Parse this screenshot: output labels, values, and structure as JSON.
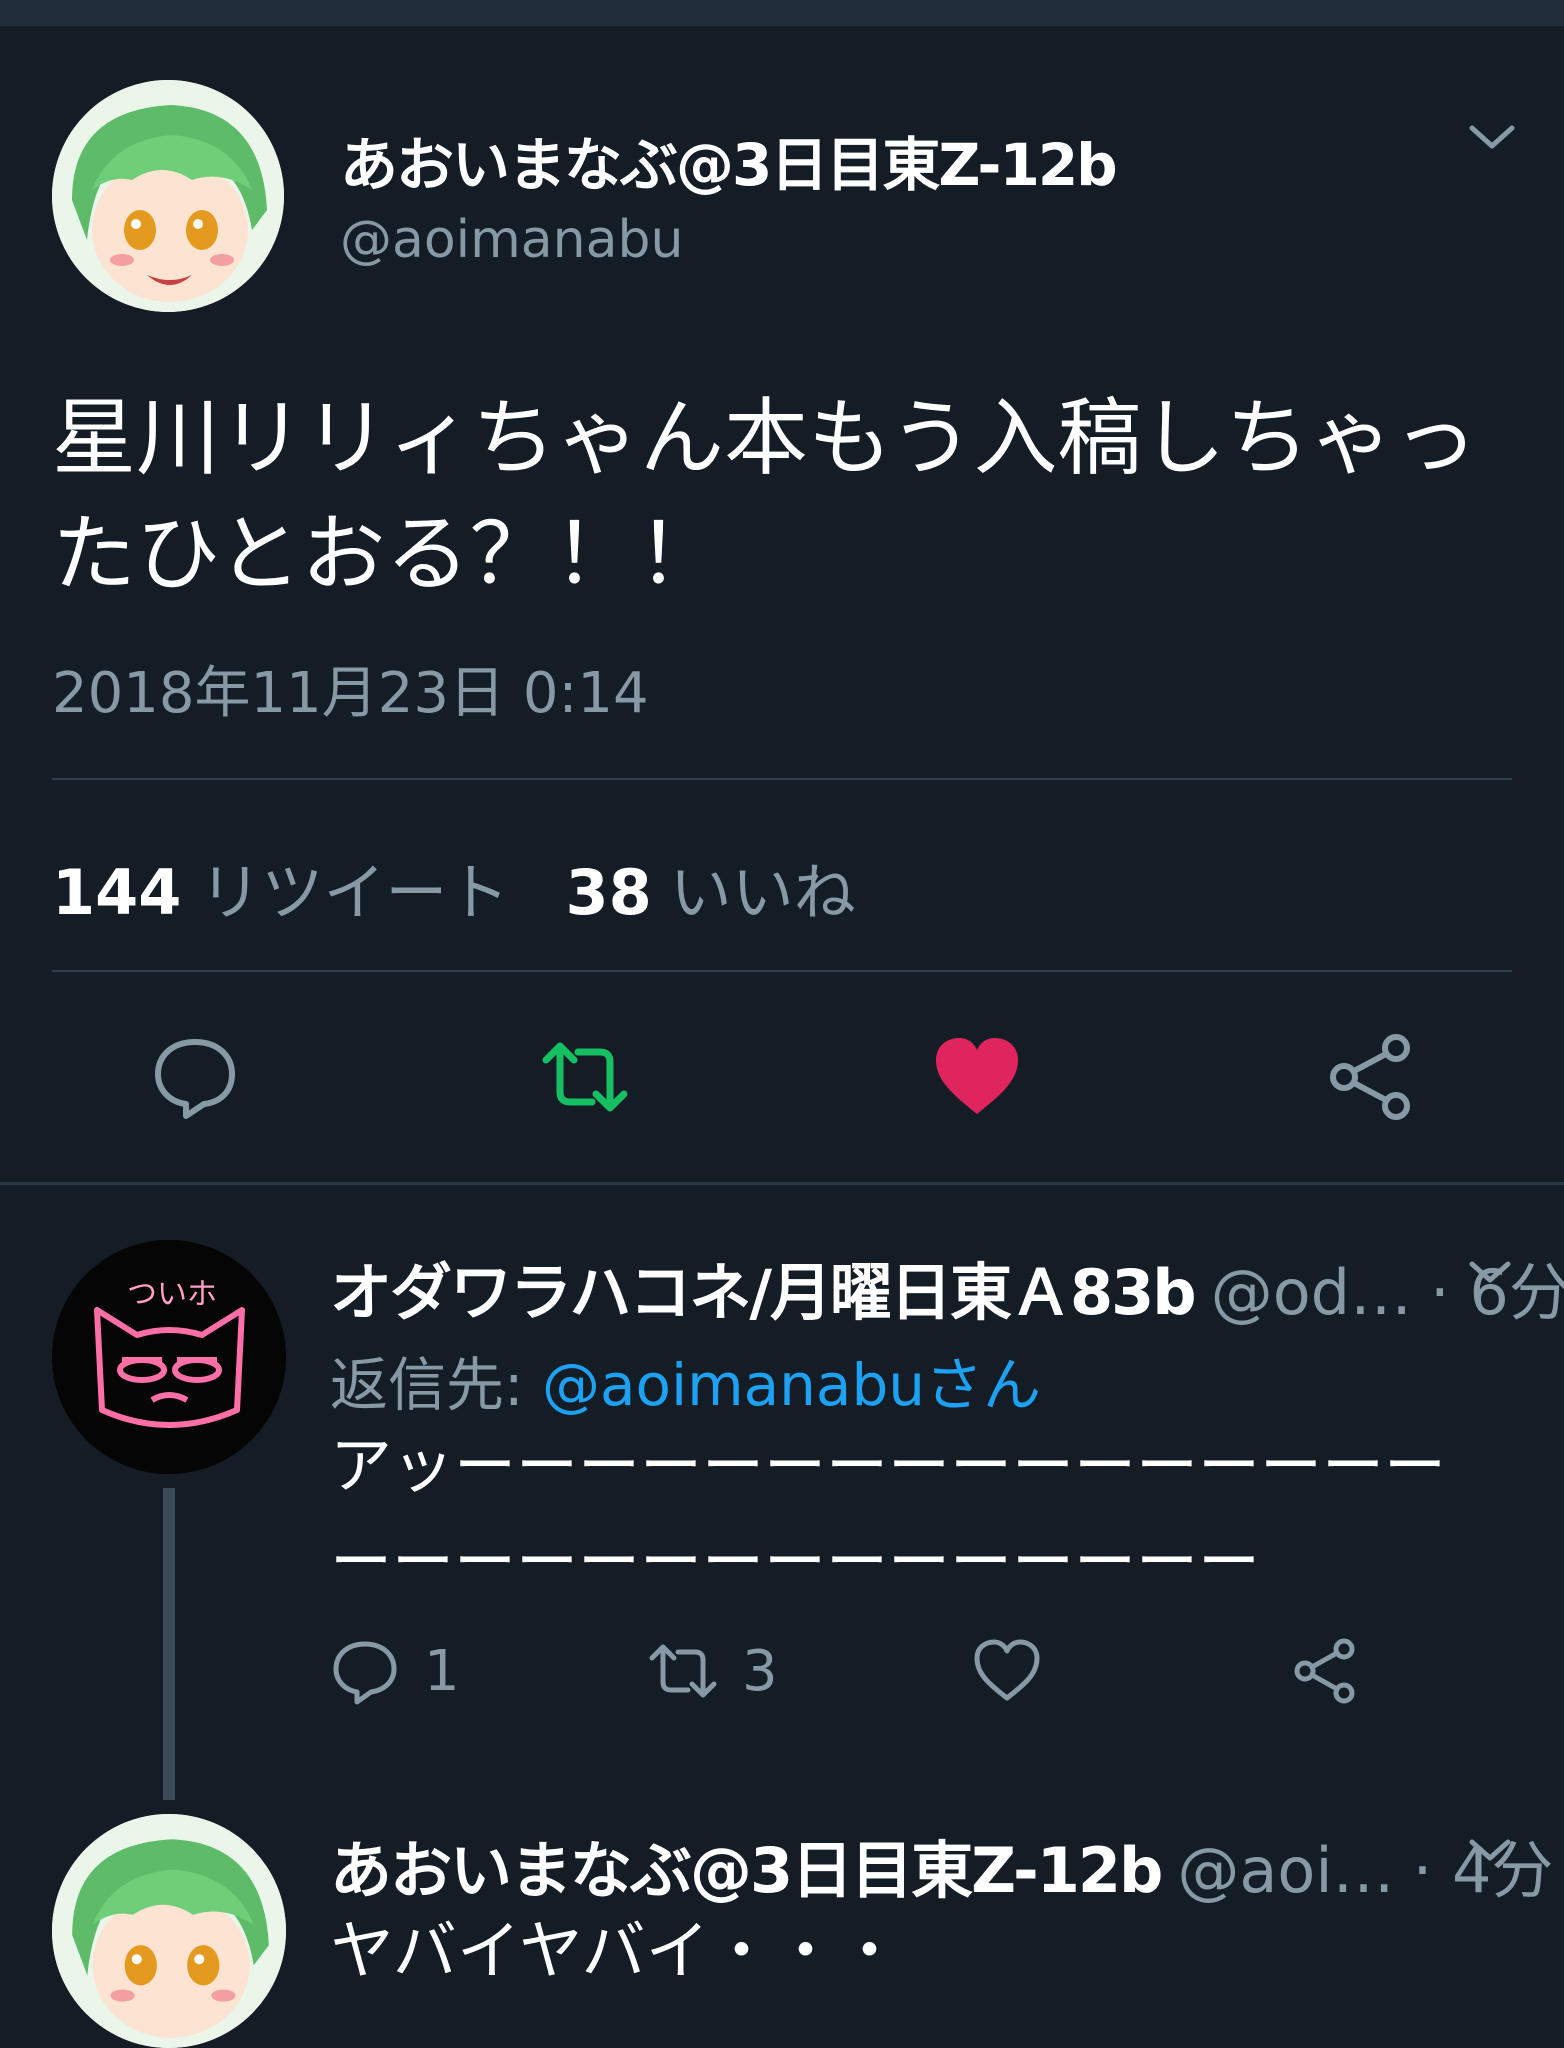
{
  "main_tweet": {
    "display_name": "あおいまなぶ@3日目東Z-12b",
    "handle": "@aoimanabu",
    "text": "星川リリィちゃん本もう入稿しちゃったひとおる？！！",
    "timestamp": "2018年11月23日 0:14",
    "retweet_count": "144",
    "retweet_label": "リツイート",
    "like_count": "38",
    "like_label": "いいね",
    "avatar_icon": "anime-avatar-green-hair",
    "colors": {
      "retweet_active": "#17bf63",
      "like_active": "#e0245e",
      "muted": "#8899a6"
    }
  },
  "reply": {
    "display_name": "オダワラハコネ/月曜日東Ａ83b",
    "handle": "@od…",
    "time": "· 6分",
    "reply_to_label": "返信先:",
    "reply_to_mention": "@aoimanabuさん",
    "text": "アッーーーーーーーーーーーーーーーーーーーーーーーーーーーーーーー",
    "reply_count": "1",
    "retweet_count": "3",
    "avatar_icon": "neon-cat-avatar",
    "avatar_text": "ついホ"
  },
  "reply2": {
    "display_name": "あおいまなぶ@3日目東Z-12b",
    "handle": "@aoi…",
    "time": "· 4分",
    "text": "ヤバイヤバイ・・・"
  }
}
